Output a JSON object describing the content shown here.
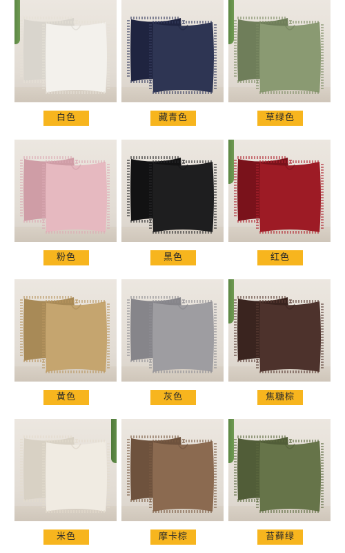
{
  "swatches": [
    {
      "label": "白色",
      "fill": "#f3f1ec",
      "shade": "#d9d5cd",
      "fringe": "#e6e1d6",
      "plant": "left"
    },
    {
      "label": "藏青色",
      "fill": "#2e3553",
      "shade": "#1f2440",
      "fringe": "#3a4163",
      "plant": "none"
    },
    {
      "label": "草绿色",
      "fill": "#8a9a72",
      "shade": "#6f7e5a",
      "fringe": "#7d8c64",
      "plant": "left"
    },
    {
      "label": "粉色",
      "fill": "#e6b9c0",
      "shade": "#cf9da6",
      "fringe": "#dcaab3",
      "plant": "none"
    },
    {
      "label": "黑色",
      "fill": "#1e1e1f",
      "shade": "#121213",
      "fringe": "#2b2b2c",
      "plant": "none"
    },
    {
      "label": "红色",
      "fill": "#9d1b25",
      "shade": "#7a121b",
      "fringe": "#b02430",
      "plant": "left"
    },
    {
      "label": "黄色",
      "fill": "#c5a56f",
      "shade": "#a88a57",
      "fringe": "#b89660",
      "plant": "none"
    },
    {
      "label": "灰色",
      "fill": "#9e9da1",
      "shade": "#86858a",
      "fringe": "#8f8e93",
      "plant": "none"
    },
    {
      "label": "焦糖棕",
      "fill": "#4d322c",
      "shade": "#3a241f",
      "fringe": "#5b3e36",
      "plant": "left"
    },
    {
      "label": "米色",
      "fill": "#f0ebe2",
      "shade": "#d8d1c4",
      "fringe": "#e3dbcd",
      "plant": "right"
    },
    {
      "label": "摩卡棕",
      "fill": "#8b6a50",
      "shade": "#6e523d",
      "fringe": "#7b5c44",
      "plant": "none"
    },
    {
      "label": "苔藓绿",
      "fill": "#667449",
      "shade": "#515d38",
      "fringe": "#5c6a40",
      "plant": "left"
    }
  ]
}
